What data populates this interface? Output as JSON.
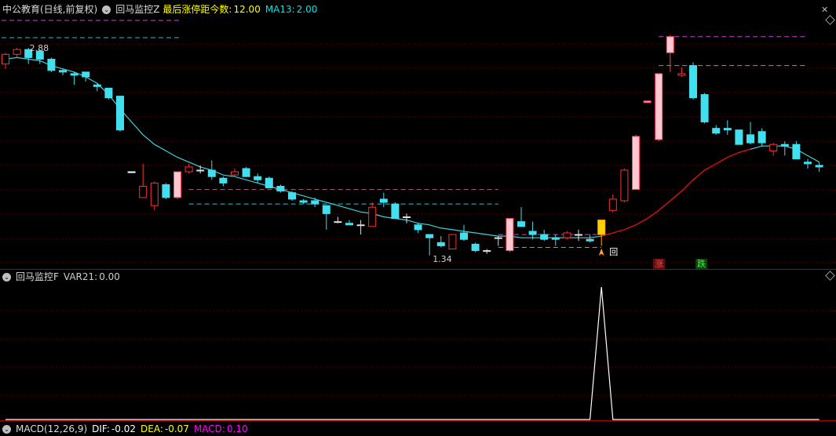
{
  "main_panel": {
    "stock_label": "中公教育(日线,前复权)",
    "indicator_name": "回马监控Z",
    "fields": [
      {
        "label": "最后涨停距今数:",
        "value": "12.00",
        "color": "#ffff00"
      },
      {
        "label": "MA13:",
        "value": "2.00",
        "color": "#00e5e5"
      }
    ],
    "high_label": "2.88",
    "low_label": "1.34",
    "pullback_label": "回",
    "rise_label": "涨",
    "fall_label": "跌"
  },
  "sub_panel": {
    "indicator_name": "回马监控F",
    "fields": [
      {
        "label": "VAR21:",
        "value": "0.00",
        "color": "#cccccc"
      }
    ]
  },
  "macd_panel": {
    "indicator_name": "MACD(12,26,9)",
    "fields": [
      {
        "label": "DIF:",
        "value": "-0.02",
        "color": "#ffffff"
      },
      {
        "label": "DEA:",
        "value": "-0.07",
        "color": "#ffff00"
      },
      {
        "label": "MACD:",
        "value": "0.10",
        "color": "#ff00ff"
      }
    ]
  },
  "colors": {
    "up": "#ff3030",
    "down": "#40e0f0",
    "ma_line": "#40d0d8",
    "ma_line_red": "#dd1010",
    "magenta_dash": "#d040d0",
    "cyan_dash": "#30c0c8",
    "signal_candle": "#ffd000",
    "separator": "#b00000"
  },
  "chart_data": {
    "type": "candlestick",
    "series": [
      {
        "name": "K线",
        "values": [
          [
            2.79,
            2.85,
            2.76,
            2.86
          ],
          [
            2.85,
            2.88,
            2.83,
            2.89
          ],
          [
            2.88,
            2.83,
            2.79,
            2.89
          ],
          [
            2.87,
            2.82,
            2.79,
            2.88
          ],
          [
            2.82,
            2.75,
            2.74,
            2.83
          ],
          [
            2.75,
            2.74,
            2.72,
            2.76
          ],
          [
            2.73,
            2.72,
            2.66,
            2.74
          ],
          [
            2.74,
            2.71,
            2.68,
            2.74
          ],
          [
            2.66,
            2.65,
            2.62,
            2.67
          ],
          [
            2.64,
            2.58,
            2.57,
            2.64
          ],
          [
            2.59,
            2.38,
            2.37,
            2.59
          ],
          [
            2.12,
            2.12,
            2.12,
            2.12
          ],
          [
            1.96,
            2.03,
            1.96,
            2.17
          ],
          [
            1.91,
            2.05,
            1.88,
            2.06
          ],
          [
            2.04,
            1.96,
            1.95,
            2.05
          ],
          [
            1.96,
            2.12,
            1.95,
            2.12
          ],
          [
            2.12,
            2.15,
            2.11,
            2.17
          ],
          [
            2.13,
            2.13,
            2.11,
            2.16
          ],
          [
            2.13,
            2.09,
            2.07,
            2.19
          ],
          [
            2.08,
            2.05,
            2.03,
            2.09
          ],
          [
            2.1,
            2.12,
            2.09,
            2.14
          ],
          [
            2.14,
            2.09,
            2.09,
            2.15
          ],
          [
            2.09,
            2.07,
            2.05,
            2.11
          ],
          [
            2.08,
            2.02,
            2.02,
            2.09
          ],
          [
            2.03,
            2.0,
            1.99,
            2.04
          ],
          [
            1.99,
            1.95,
            1.94,
            2.0
          ],
          [
            1.94,
            1.93,
            1.92,
            1.95
          ],
          [
            1.94,
            1.92,
            1.9,
            1.96
          ],
          [
            1.91,
            1.86,
            1.76,
            1.91
          ],
          [
            1.81,
            1.81,
            1.8,
            1.84
          ],
          [
            1.8,
            1.79,
            1.79,
            1.82
          ],
          [
            1.79,
            1.79,
            1.73,
            1.82
          ],
          [
            1.78,
            1.9,
            1.78,
            1.93
          ],
          [
            1.95,
            1.93,
            1.9,
            1.99
          ],
          [
            1.92,
            1.83,
            1.83,
            1.93
          ],
          [
            1.84,
            1.84,
            1.8,
            1.86
          ],
          [
            1.79,
            1.76,
            1.74,
            1.8
          ],
          [
            1.73,
            1.71,
            1.6,
            1.73
          ],
          [
            1.68,
            1.66,
            1.65,
            1.72
          ],
          [
            1.64,
            1.73,
            1.64,
            1.73
          ],
          [
            1.74,
            1.7,
            1.69,
            1.79
          ],
          [
            1.67,
            1.63,
            1.62,
            1.68
          ],
          [
            1.63,
            1.63,
            1.61,
            1.64
          ],
          [
            1.71,
            1.71,
            1.66,
            1.72
          ],
          [
            1.63,
            1.83,
            1.62,
            1.83
          ],
          [
            1.81,
            1.78,
            1.78,
            1.9
          ],
          [
            1.75,
            1.73,
            1.7,
            1.81
          ],
          [
            1.73,
            1.7,
            1.69,
            1.76
          ],
          [
            1.71,
            1.7,
            1.66,
            1.73
          ],
          [
            1.71,
            1.74,
            1.7,
            1.75
          ],
          [
            1.73,
            1.73,
            1.69,
            1.76
          ],
          [
            1.7,
            1.69,
            1.68,
            1.73
          ],
          [
            1.73,
            1.82,
            1.66,
            1.82
          ],
          [
            1.88,
            1.95,
            1.87,
            1.98
          ],
          [
            1.94,
            2.13,
            1.93,
            2.14
          ],
          [
            2.01,
            2.34,
            2.01,
            2.35
          ],
          [
            2.55,
            2.56,
            2.55,
            2.56
          ],
          [
            2.32,
            2.73,
            2.31,
            2.73
          ],
          [
            2.86,
            2.96,
            2.74,
            2.97
          ],
          [
            2.72,
            2.73,
            2.71,
            2.77
          ],
          [
            2.78,
            2.58,
            2.57,
            2.8
          ],
          [
            2.6,
            2.43,
            2.42,
            2.61
          ],
          [
            2.39,
            2.36,
            2.35,
            2.41
          ],
          [
            2.39,
            2.38,
            2.35,
            2.44
          ],
          [
            2.38,
            2.29,
            2.3,
            2.38
          ],
          [
            2.35,
            2.3,
            2.29,
            2.43
          ],
          [
            2.37,
            2.3,
            2.28,
            2.39
          ],
          [
            2.25,
            2.29,
            2.22,
            2.3
          ],
          [
            2.29,
            2.28,
            2.22,
            2.31
          ],
          [
            2.29,
            2.2,
            2.2,
            2.31
          ],
          [
            2.18,
            2.17,
            2.14,
            2.2
          ],
          [
            2.16,
            2.15,
            2.12,
            2.18
          ]
        ]
      },
      {
        "name": "MA13 曲线",
        "values": [
          2.82,
          2.83,
          2.82,
          2.81,
          2.78,
          2.76,
          2.74,
          2.71,
          2.67,
          2.6,
          2.51,
          2.43,
          2.35,
          2.29,
          2.25,
          2.21,
          2.18,
          2.15,
          2.13,
          2.1,
          2.09,
          2.07,
          2.05,
          2.03,
          2.01,
          1.99,
          1.97,
          1.95,
          1.93,
          1.91,
          1.89,
          1.87,
          1.86,
          1.84,
          1.83,
          1.82,
          1.8,
          1.79,
          1.77,
          1.76,
          1.75,
          1.74,
          1.73,
          1.72,
          1.72,
          1.71,
          1.71,
          1.71,
          1.71,
          1.71,
          1.71,
          1.71,
          1.72,
          1.74,
          1.76,
          1.79,
          1.83,
          1.88,
          1.94,
          2.0,
          2.07,
          2.13,
          2.17,
          2.21,
          2.24,
          2.26,
          2.28,
          2.28,
          2.28,
          2.26,
          2.22,
          2.18
        ]
      },
      {
        "name": "VAR21",
        "values": [
          0,
          0,
          0,
          0,
          0,
          0,
          0,
          0,
          0,
          0,
          0,
          0,
          0,
          0,
          0,
          0,
          0,
          0,
          0,
          0,
          0,
          0,
          0,
          0,
          0,
          0,
          0,
          0,
          0,
          0,
          0,
          0,
          0,
          0,
          0,
          0,
          0,
          0,
          0,
          0,
          0,
          0,
          0,
          0,
          0,
          0,
          0,
          0,
          0,
          0,
          0,
          0,
          1,
          0,
          0,
          0,
          0,
          0,
          0,
          0,
          0,
          0,
          0,
          0,
          0,
          0,
          0,
          0,
          0,
          0,
          0,
          0
        ]
      }
    ],
    "levels": [
      {
        "from": 16,
        "to": 43,
        "value": 2.01,
        "color": "magenta"
      },
      {
        "from": 16,
        "to": 43,
        "value": 1.92,
        "color": "cyan"
      },
      {
        "from": 43,
        "to": 52,
        "value": 1.73,
        "color": "magenta"
      },
      {
        "from": 43,
        "to": 52,
        "value": 1.65,
        "color": "cyan"
      },
      {
        "from": 57,
        "to": 70,
        "value": 2.96,
        "color": "magenta"
      },
      {
        "from": 57,
        "to": 70,
        "value": 2.78,
        "color": "cyan"
      }
    ],
    "signal_index": 52,
    "high_index": 1,
    "low_index": 37,
    "rise_index": 57,
    "fall_index": 60,
    "ylim": [
      1.55,
      3.1
    ],
    "grid": true
  }
}
